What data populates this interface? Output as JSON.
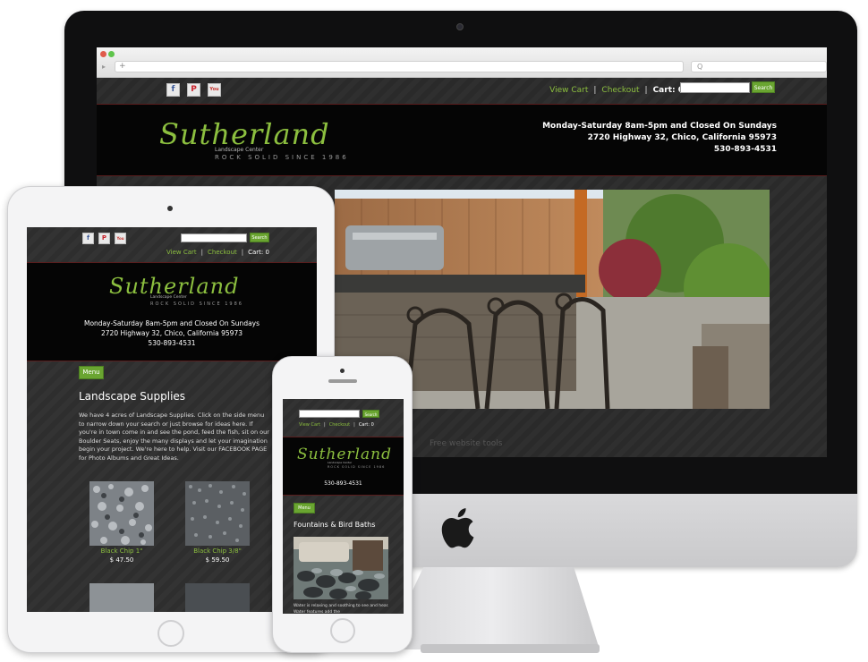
{
  "desktop": {
    "browser": {
      "address_placeholder": "+",
      "search_placeholder": "Q"
    },
    "topbar": {
      "social": [
        "f",
        "P",
        "You"
      ],
      "view_cart": "View Cart",
      "checkout": "Checkout",
      "cart": "Cart: 0",
      "search_button": "Search"
    },
    "header": {
      "logo_script": "Sutherland",
      "logo_sub": "Landscape Center",
      "logo_tag": "ROCK SOLID SINCE 1986",
      "hours": "Monday-Saturday 8am-5pm and Closed On Sundays",
      "address": "2720 Highway 32, Chico, California 95973",
      "phone": "530-893-4531"
    },
    "footer_note": "Free website tools"
  },
  "tablet": {
    "search_button": "Search",
    "view_cart": "View Cart",
    "checkout": "Checkout",
    "cart": "Cart: 0",
    "logo_script": "Sutherland",
    "logo_sub": "Landscape Center",
    "logo_tag": "ROCK SOLID SINCE 1986",
    "hours": "Monday-Saturday 8am-5pm and Closed On Sundays",
    "address": "2720 Highway 32, Chico, California 95973",
    "phone": "530-893-4531",
    "menu": "Menu",
    "title": "Landscape Supplies",
    "description": "We have 4 acres of Landscape Supplies.  Click on the side menu to narrow down your search or just browse for ideas here.  If you're in town come in and see the pond, feed the fish, sit on our Boulder Seats, enjoy the many displays and let your imagination begin your project.  We're here to help. Visit our FACEBOOK PAGE for Photo Albums and Great Ideas.",
    "products": [
      {
        "name": "Black Chip 1\"",
        "price": "$ 47.50"
      },
      {
        "name": "Black Chip 3/8\"",
        "price": "$ 59.50"
      }
    ]
  },
  "phone": {
    "search_button": "Search",
    "view_cart": "View Cart",
    "checkout": "Checkout",
    "cart": "Cart: 0",
    "logo_script": "Sutherland",
    "logo_sub": "Landscape Center",
    "logo_tag": "ROCK SOLID SINCE 1986",
    "phone": "530-893-4531",
    "menu": "Menu",
    "title": "Fountains & Bird Baths",
    "description": "Water is relaxing and soothing to see and hear.  Water features add the"
  },
  "colors": {
    "accent": "#8cbf3f",
    "button": "#6aa531",
    "divider": "#5a1d1d",
    "header_bg": "#050505"
  }
}
